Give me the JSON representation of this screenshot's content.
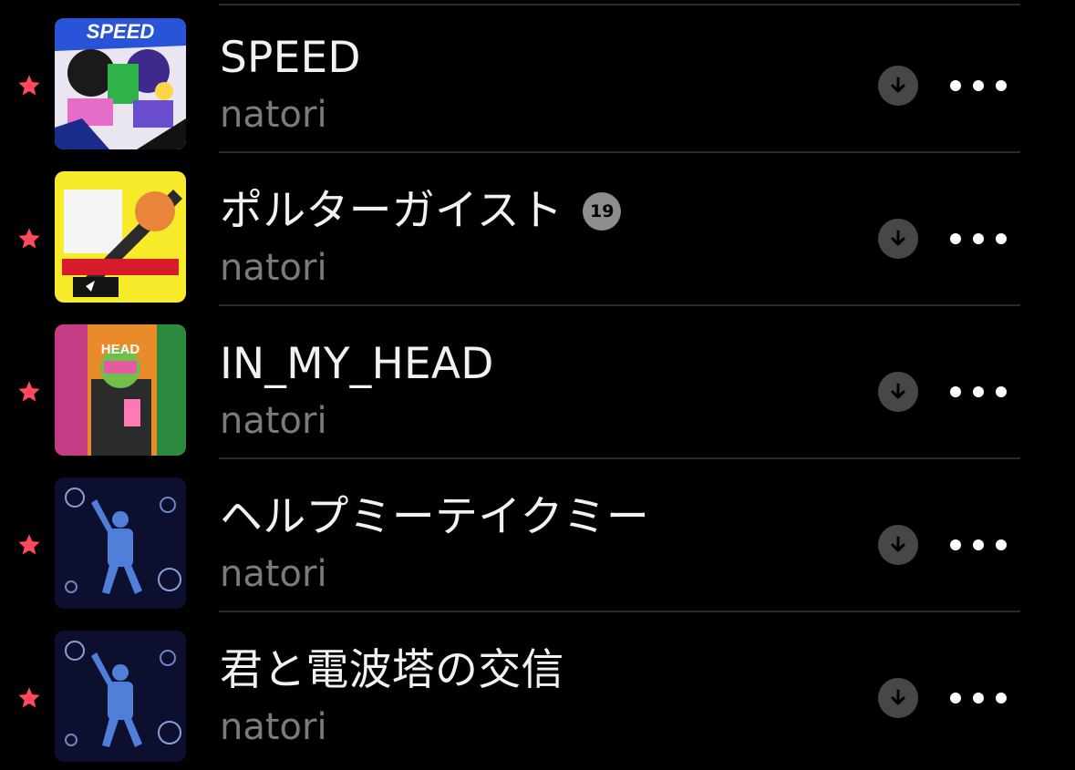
{
  "colors": {
    "background": "#000000",
    "favorite_star": "#ff4a5a",
    "title_text": "#f2f2f2",
    "artist_text": "#7b7b7b",
    "divider": "#2b2b2b",
    "download_button_bg": "#474747",
    "badge_bg": "#8e8e8e"
  },
  "tracks": [
    {
      "title": "SPEED",
      "artist": "natori",
      "art_text": "SPEED",
      "favorited": true,
      "download_icon": "arrow-down-circle-icon",
      "more_icon": "ellipsis-icon"
    },
    {
      "title": "ポルターガイスト",
      "artist": "natori",
      "badge": "19",
      "favorited": true,
      "download_icon": "arrow-down-circle-icon",
      "more_icon": "ellipsis-icon"
    },
    {
      "title": "IN_MY_HEAD",
      "artist": "natori",
      "art_text": "HEAD",
      "favorited": true,
      "download_icon": "arrow-down-circle-icon",
      "more_icon": "ellipsis-icon"
    },
    {
      "title": "ヘルプミーテイクミー",
      "artist": "natori",
      "favorited": true,
      "download_icon": "arrow-down-circle-icon",
      "more_icon": "ellipsis-icon"
    },
    {
      "title": "君と電波塔の交信",
      "artist": "natori",
      "favorited": true,
      "download_icon": "arrow-down-circle-icon",
      "more_icon": "ellipsis-icon"
    }
  ]
}
